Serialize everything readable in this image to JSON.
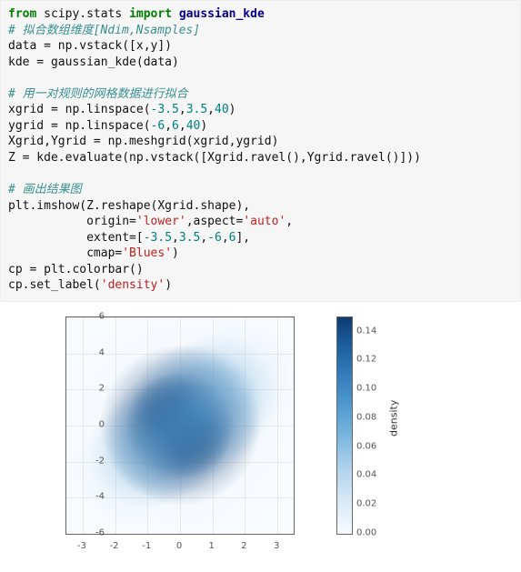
{
  "code": {
    "l1a": "from",
    "l1b": " scipy.stats ",
    "l1c": "import",
    "l1d": " gaussian_kde",
    "l2": "# 拟合数组维度[Ndim,Nsamples]",
    "l3": "data = np.vstack([x,y])",
    "l4": "kde = gaussian_kde(data)",
    "blank1": "",
    "l5": "# 用一对规则的网格数据进行拟合",
    "l6a": "xgrid = np.linspace(",
    "l6b": "-3.5",
    "l6c": ",",
    "l6d": "3.5",
    "l6e": ",",
    "l6f": "40",
    "l6g": ")",
    "l7a": "ygrid = np.linspace(",
    "l7b": "-6",
    "l7c": ",",
    "l7d": "6",
    "l7e": ",",
    "l7f": "40",
    "l7g": ")",
    "l8": "Xgrid,Ygrid = np.meshgrid(xgrid,ygrid)",
    "l9": "Z = kde.evaluate(np.vstack([Xgrid.ravel(),Ygrid.ravel()]))",
    "blank2": "",
    "l10": "# 画出结果图",
    "l11": "plt.imshow(Z.reshape(Xgrid.shape),",
    "l12a": "           origin=",
    "l12b": "'lower'",
    "l12c": ",aspect=",
    "l12d": "'auto'",
    "l12e": ",",
    "l13a": "           extent=[",
    "l13b": "-3.5",
    "l13c": ",",
    "l13d": "3.5",
    "l13e": ",",
    "l13f": "-6",
    "l13g": ",",
    "l13h": "6",
    "l13i": "],",
    "l14a": "           cmap=",
    "l14b": "'Blues'",
    "l14c": ")",
    "l15": "cp = plt.colorbar()",
    "l16a": "cp.set_label(",
    "l16b": "'density'",
    "l16c": ")"
  },
  "chart_data": {
    "type": "heatmap",
    "title": "",
    "xlabel": "",
    "ylabel": "",
    "xlim": [
      -3.5,
      3.5
    ],
    "ylim": [
      -6,
      6
    ],
    "x_ticks": [
      -3,
      -2,
      -1,
      0,
      1,
      2,
      3
    ],
    "y_ticks": [
      -6,
      -4,
      -2,
      0,
      2,
      4,
      6
    ],
    "colorbar_label": "density",
    "colorbar_ticks": [
      0.0,
      0.02,
      0.04,
      0.06,
      0.08,
      0.1,
      0.12,
      0.14
    ],
    "colorbar_tick_labels": [
      "0.00",
      "0.02",
      "0.04",
      "0.06",
      "0.08",
      "0.10",
      "0.12",
      "0.14"
    ],
    "zrange": [
      0.0,
      0.15
    ],
    "cmap": "Blues",
    "grid_size": [
      40,
      40
    ],
    "description": "2D Gaussian KDE of correlated data; peak near (0,0), elongated along positive diagonal; low density toward corners."
  }
}
